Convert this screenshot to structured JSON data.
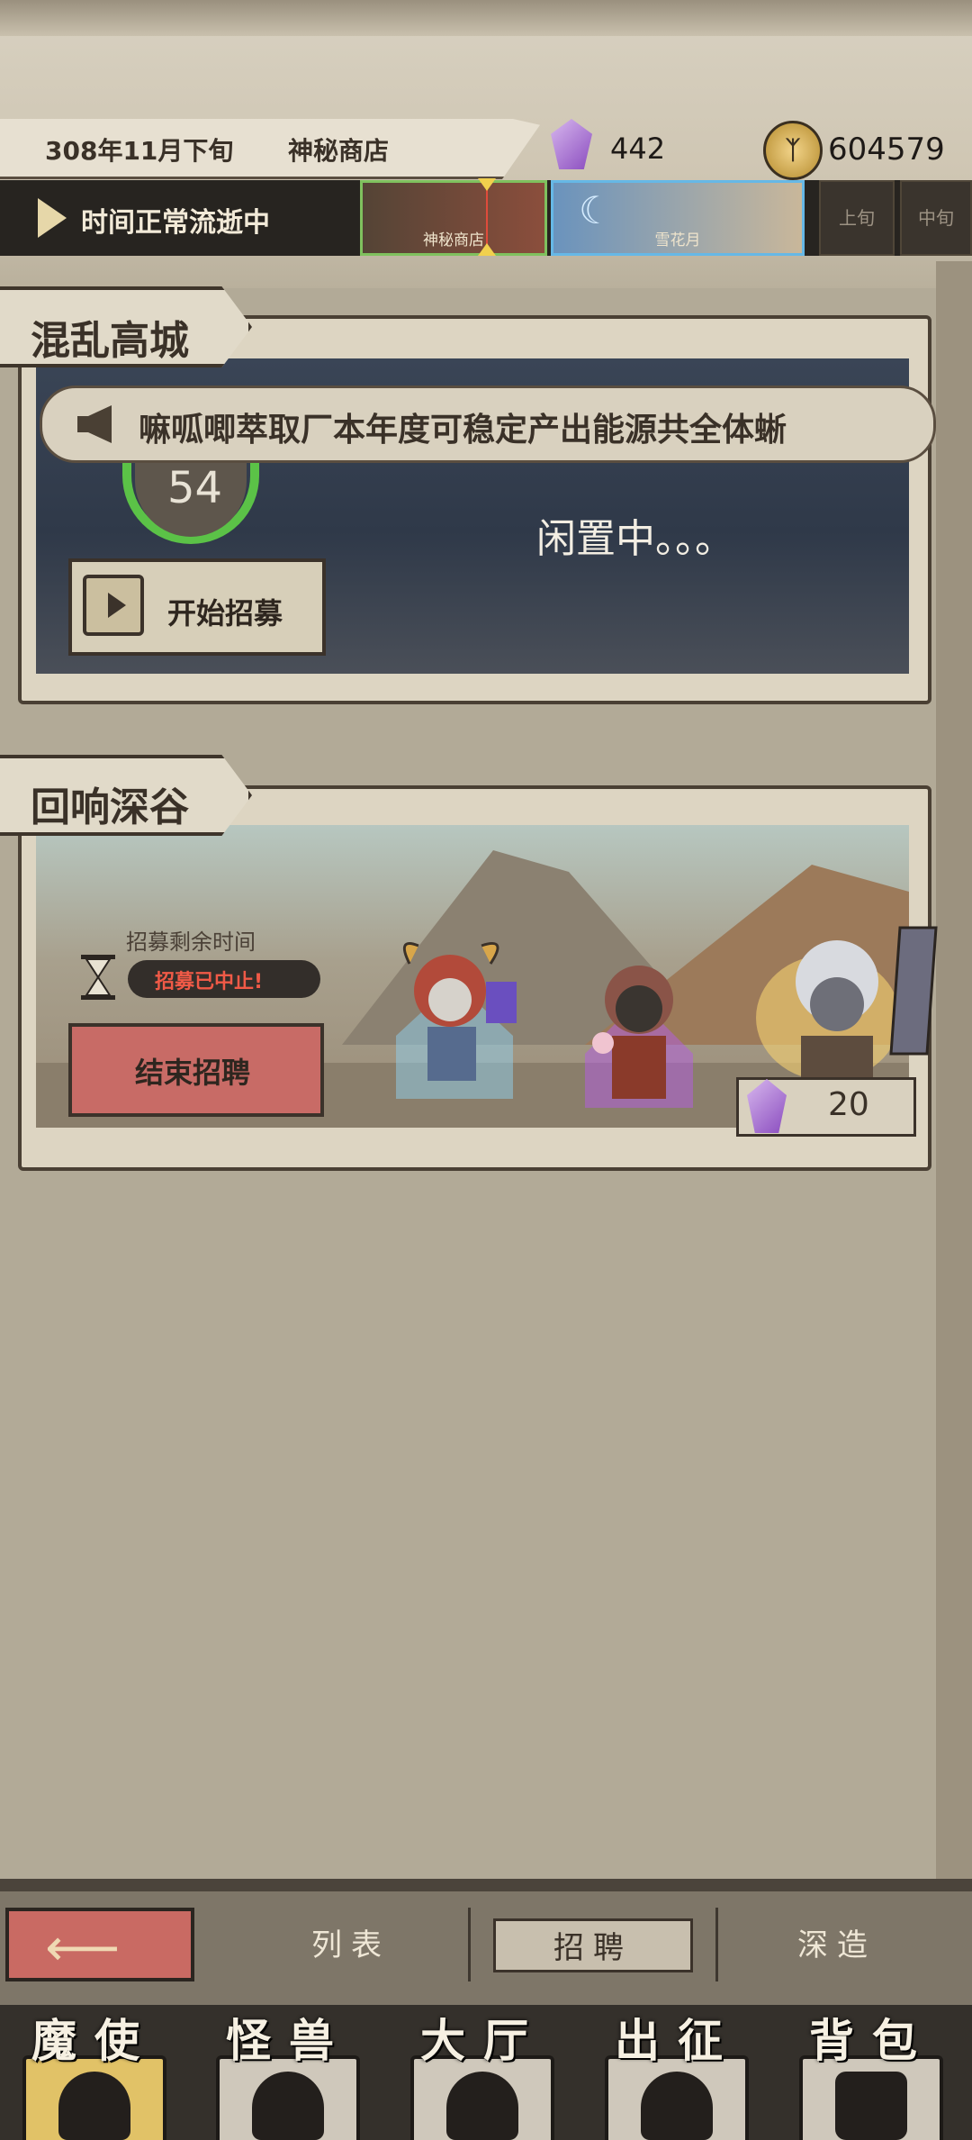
{
  "header": {
    "date": "308年11月下旬",
    "location": "神秘商店",
    "gems": "442",
    "coins": "604579",
    "coin_icon": "rune-coin-icon",
    "gem_icon": "purple-crystal-icon"
  },
  "time_bar": {
    "status": "时间正常流逝中",
    "calendar": [
      {
        "label": "神秘商店"
      },
      {
        "label": "雪花月"
      },
      {
        "label": "上旬"
      },
      {
        "label": "中旬"
      }
    ]
  },
  "panels": [
    {
      "title": "混乱高城",
      "announcement": "嘛呱唧萃取厂本年度可稳定产出能源共全体蜥",
      "counter": "54",
      "status": "闲置中。。。",
      "button": "开始招募"
    },
    {
      "title": "回响深谷",
      "remaining_label": "招募剩余时间",
      "stopped_label": "招募已中止!",
      "button": "结束招聘",
      "cost": "20"
    }
  ],
  "subtabs": {
    "list": "列表",
    "recruit": "招聘",
    "forge": "深造"
  },
  "nav": [
    "魔使",
    "怪兽",
    "大厅",
    "出征",
    "背包"
  ],
  "colors": {
    "accent_green": "#5bc247",
    "alert_red": "#f05a47",
    "button_red": "#c86b66",
    "parchment": "#ddd5c2"
  }
}
